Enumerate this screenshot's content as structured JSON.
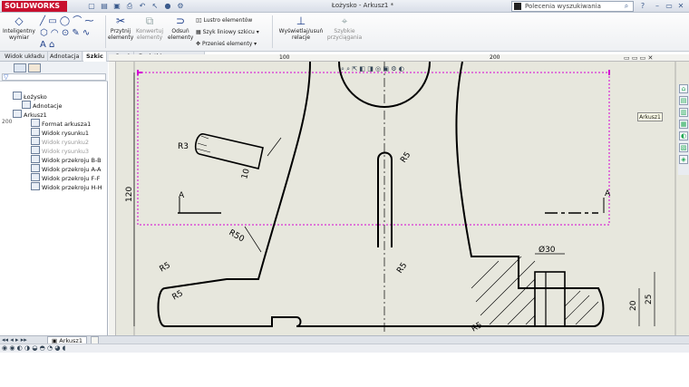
{
  "app": {
    "logo_text": "SOLIDWORKS",
    "document_title": "Łożysko - Arkusz1 *"
  },
  "search": {
    "placeholder": "Polecenia wyszukiwania"
  },
  "ribbon": {
    "smart_dimension": "Inteligentny wymiar",
    "trim": "Przytnij elementy",
    "convert": "Konwertuj elementy",
    "offset": "Odsuń elementy",
    "mirror": "Lustro elementów",
    "pattern": "Szyk liniowy szkicu",
    "move": "Przenieś elementy",
    "display_relations": "Wyświetlaj/usuń relacje",
    "quick_snaps": "Szybkie przyciągania"
  },
  "tabs": [
    "Widok układu",
    "Adnotacja",
    "Szkic",
    "Oceń",
    "Dodatki SOLIDWORKS"
  ],
  "active_tab": "Szkic",
  "tree": {
    "root": "Łożysko",
    "items": [
      {
        "label": "Adnotacje",
        "grey": false
      },
      {
        "label": "Arkusz1",
        "grey": false
      },
      {
        "label": "Format arkusza1",
        "grey": false
      },
      {
        "label": "Widok rysunku1",
        "grey": false
      },
      {
        "label": "Widok rysunku2",
        "grey": true
      },
      {
        "label": "Widok rysunku3",
        "grey": true
      },
      {
        "label": "Widok przekroju B-B",
        "grey": false
      },
      {
        "label": "Widok przekroju A-A",
        "grey": false
      },
      {
        "label": "Widok przekroju F-F",
        "grey": false
      },
      {
        "label": "Widok przekroju H-H",
        "grey": false
      }
    ]
  },
  "ruler": {
    "t100": "100",
    "t200": "200",
    "v200": "200"
  },
  "tooltip": "Arkusz1",
  "sheet_tab": "Arkusz1",
  "drawing": {
    "r3": "R3",
    "d10": "10",
    "r5a": "R5",
    "a_left": "A",
    "a_right": "A",
    "d120": "120",
    "r50": "R50",
    "r5b": "R5",
    "r5c": "R5",
    "r5d": "R5",
    "r5e": "R5",
    "phi30": "Ø30",
    "d20": "20",
    "d25": "25"
  }
}
